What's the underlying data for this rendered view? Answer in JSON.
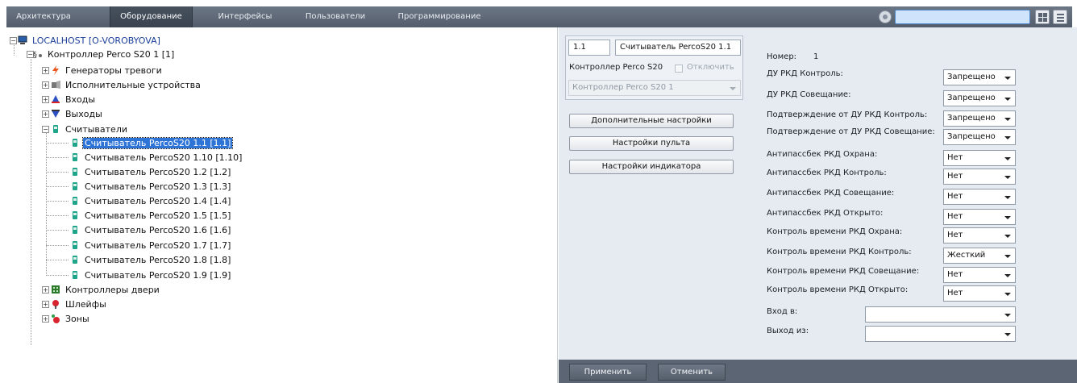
{
  "menu": {
    "tabs": [
      "Архитектура",
      "Оборудование",
      "Интерфейсы",
      "Пользователи",
      "Программирование"
    ],
    "active_tab": "Оборудование"
  },
  "tree": {
    "root": "LOCALHOST [O-VOROBYOVA]",
    "controller": "Контроллер Perco S20 1 [1]",
    "groups": [
      "Генераторы тревоги",
      "Исполнительные устройства",
      "Входы",
      "Выходы",
      "Считыватели"
    ],
    "readers": [
      "Считыватель PercoS20 1.1 [1.1]",
      "Считыватель PercoS20 1.10 [1.10]",
      "Считыватель PercoS20 1.2 [1.2]",
      "Считыватель PercoS20 1.3 [1.3]",
      "Считыватель PercoS20 1.4 [1.4]",
      "Считыватель PercoS20 1.5 [1.5]",
      "Считыватель PercoS20 1.6 [1.6]",
      "Считыватель PercoS20 1.7 [1.7]",
      "Считыватель PercoS20 1.8 [1.8]",
      "Считыватель PercoS20 1.9 [1.9]"
    ],
    "selected_reader": "Считыватель PercoS20 1.1 [1.1]",
    "root_groups": [
      "Контроллеры двери",
      "Шлейфы",
      "Зоны"
    ]
  },
  "object": {
    "id": "1.1",
    "name": "Считыватель PercoS20 1.1",
    "parent_label": "Контроллер Perco S20",
    "disable_label": "Отключить",
    "parent_select": "Контроллер Perco S20 1"
  },
  "buttons": {
    "additional": "Дополнительные настройки",
    "console": "Настройки пульта",
    "indicator": "Настройки индикатора",
    "apply": "Применить",
    "cancel": "Отменить"
  },
  "settings": {
    "number_label": "Номер:",
    "number_value": "1",
    "rows": [
      {
        "label": "ДУ РКД Контроль:",
        "value": "Запрещено"
      },
      {
        "label": "ДУ РКД Совещание:",
        "value": "Запрещено"
      },
      {
        "label": "Подтверждение от ДУ РКД Контроль:",
        "value": "Запрещено"
      },
      {
        "label": "Подтверждение от ДУ РКД Совещание:",
        "value": "Запрещено"
      },
      {
        "label": "Антипассбек РКД Охрана:",
        "value": "Нет"
      },
      {
        "label": "Антипассбек РКД Контроль:",
        "value": "Нет"
      },
      {
        "label": "Антипассбек РКД Совещание:",
        "value": "Нет"
      },
      {
        "label": "Антипассбек РКД Открыто:",
        "value": "Нет"
      },
      {
        "label": "Контроль времени РКД Охрана:",
        "value": "Нет"
      },
      {
        "label": "Контроль времени РКД Контроль:",
        "value": "Жесткий"
      },
      {
        "label": "Контроль времени РКД Совещание:",
        "value": "Нет"
      },
      {
        "label": "Контроль времени РКД Открыто:",
        "value": "Нет"
      }
    ],
    "entry_label": "Вход в:",
    "entry_value": "",
    "exit_label": "Выход из:",
    "exit_value": ""
  },
  "colors": {
    "menubar": "#5f6a79",
    "selection": "#2e74d6",
    "panel": "#e6ebf1"
  }
}
